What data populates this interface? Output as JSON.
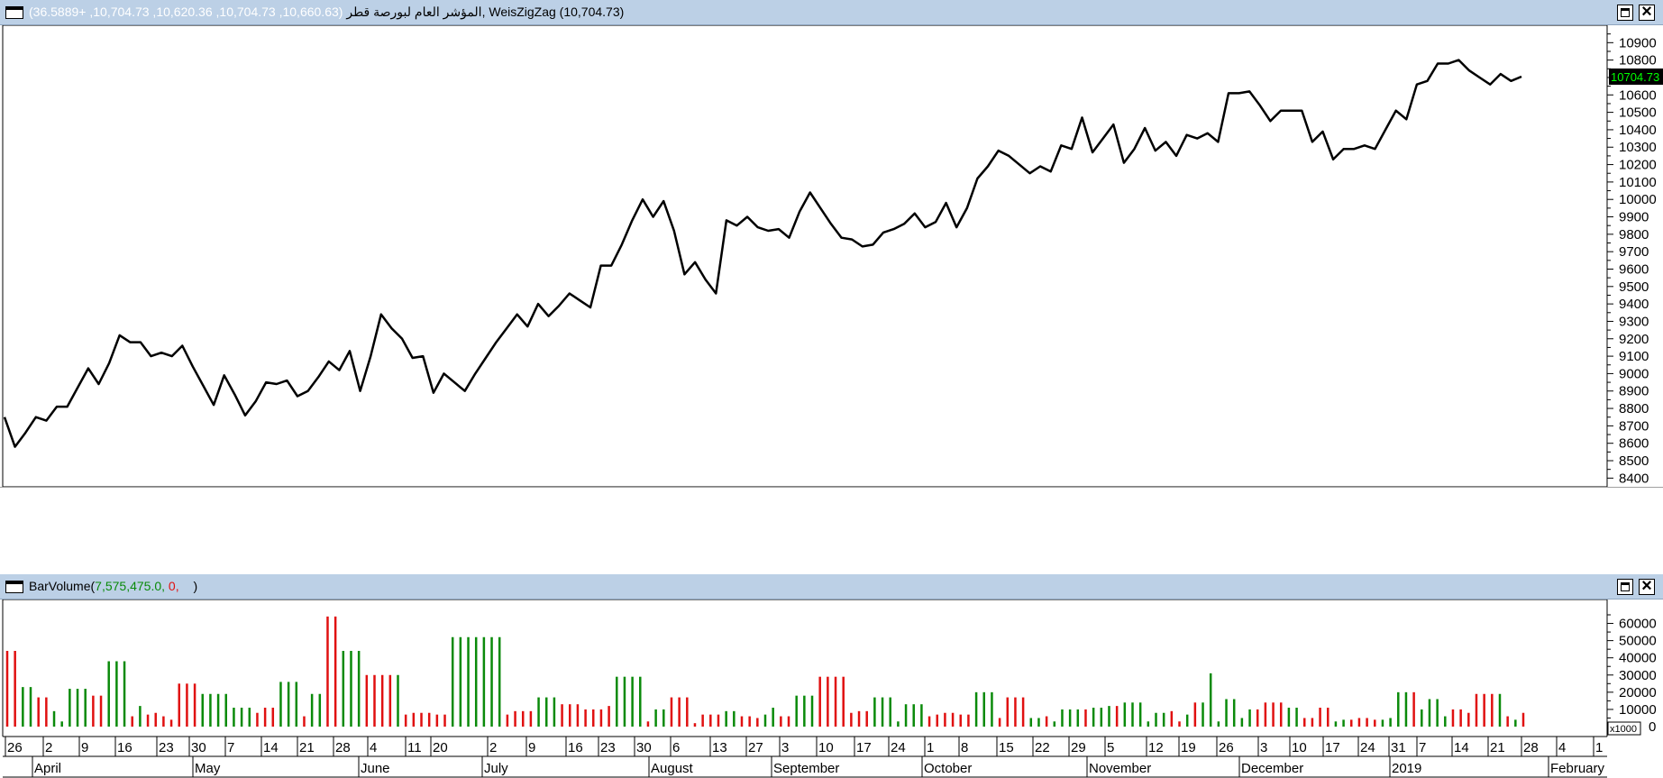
{
  "colors": {
    "titlebar": "#bcd0e6",
    "up_bar": "#0a8a0a",
    "down_bar": "#e01010",
    "price_line": "#000000",
    "last_price_badge_bg": "#000000",
    "last_price_badge_text": "#00ff00"
  },
  "price_panel": {
    "title": "المؤشر العام لبورصة قطر",
    "ohlc_values": "(10,660.63, 10,704.73, 10,620.36, 10,704.73, +36.5889)",
    "separator": ",",
    "indicator": "WeisZigZag (10,704.73)",
    "last_price_label": "10704.73",
    "maximize_icon": "maximize-icon",
    "close_icon": "close-icon"
  },
  "volume_panel": {
    "name": "BarVolume",
    "open_paren": "(",
    "value_green": "7,575,475.0,",
    "value_red": "0,",
    "close_paren": ")",
    "scale_label": "x1000"
  },
  "x_axis": {
    "day_labels": [
      "26",
      "2",
      "9",
      "16",
      "23",
      "30",
      "7",
      "14",
      "21",
      "28",
      "4",
      "11",
      "20",
      "2",
      "9",
      "16",
      "23",
      "30",
      "6",
      "13",
      "27",
      "3",
      "10",
      "17",
      "24",
      "1",
      "8",
      "15",
      "22",
      "29",
      "5",
      "12",
      "19",
      "26",
      "3",
      "10",
      "17",
      "24",
      "31",
      "7",
      "14",
      "21",
      "28",
      "4",
      "1"
    ],
    "month_labels": [
      "April",
      "May",
      "June",
      "July",
      "August",
      "September",
      "October",
      "November",
      "December",
      "2019",
      "February"
    ]
  },
  "chart_data": [
    {
      "type": "line",
      "series": [
        {
          "name": "WeisZigZag",
          "values": [
            8750,
            8580,
            8660,
            8750,
            8730,
            8810,
            8810,
            8920,
            9030,
            8940,
            9060,
            9220,
            9180,
            9180,
            9100,
            9120,
            9100,
            9160,
            9040,
            8930,
            8820,
            8990,
            8880,
            8760,
            8840,
            8950,
            8940,
            8960,
            8870,
            8900,
            8980,
            9070,
            9020,
            9130,
            8900,
            9100,
            9340,
            9260,
            9200,
            9090,
            9100,
            8890,
            9000,
            8950,
            8900,
            9000,
            9090,
            9180,
            9260,
            9340,
            9270,
            9400,
            9330,
            9390,
            9460,
            9420,
            9380,
            9620,
            9620,
            9740,
            9880,
            10000,
            9900,
            9990,
            9820,
            9570,
            9640,
            9540,
            9460,
            9880,
            9850,
            9900,
            9840,
            9820,
            9830,
            9780,
            9930,
            10040,
            9950,
            9860,
            9780,
            9770,
            9730,
            9740,
            9810,
            9830,
            9860,
            9920,
            9840,
            9870,
            9980,
            9840,
            9950,
            10120,
            10190,
            10280,
            10250,
            10200,
            10150,
            10190,
            10160,
            10310,
            10290,
            10470,
            10270,
            10350,
            10430,
            10210,
            10290,
            10410,
            10280,
            10330,
            10250,
            10370,
            10350,
            10380,
            10330,
            10610,
            10610,
            10620,
            10540,
            10450,
            10510,
            10510,
            10510,
            10330,
            10390,
            10230,
            10290,
            10290,
            10310,
            10290,
            10400,
            10510,
            10460,
            10660,
            10680,
            10780,
            10780,
            10800,
            10740,
            10700,
            10660,
            10720,
            10680,
            10705
          ]
        }
      ],
      "ylim": [
        8350,
        11000
      ]
    },
    {
      "type": "bar",
      "ylabel": "x1000",
      "ylim": [
        0,
        65000
      ],
      "series": [
        {
          "name": "BarVolume",
          "values": [
            44000,
            44000,
            23000,
            23000,
            17000,
            17000,
            9000,
            3000,
            22000,
            22000,
            22000,
            18000,
            18000,
            38000,
            38000,
            38000,
            6000,
            12000,
            7000,
            8000,
            6000,
            4000,
            25000,
            25000,
            25000,
            19000,
            19000,
            19000,
            19000,
            11000,
            11000,
            11000,
            8000,
            11000,
            11000,
            26000,
            26000,
            26000,
            6000,
            19000,
            19000,
            64000,
            64000,
            44000,
            44000,
            44000,
            30000,
            30000,
            30000,
            30000,
            30000,
            7000,
            8000,
            8000,
            8000,
            7000,
            7000,
            52000,
            52000,
            52000,
            52000,
            52000,
            52000,
            52000,
            7000,
            9000,
            9000,
            9000,
            17000,
            17000,
            17000,
            13000,
            13000,
            13000,
            10000,
            10000,
            10000,
            12000,
            29000,
            29000,
            29000,
            29000,
            3000,
            10000,
            10000,
            17000,
            17000,
            17000,
            2000,
            7000,
            7000,
            7000,
            9000,
            9000,
            6000,
            6000,
            5000,
            7000,
            11000,
            6000,
            6000,
            18000,
            18000,
            18000,
            29000,
            29000,
            29000,
            29000,
            8000,
            9000,
            9000,
            17000,
            17000,
            17000,
            3000,
            13000,
            13000,
            13000,
            6000,
            7000,
            8000,
            8000,
            7000,
            7000,
            20000,
            20000,
            20000,
            5000,
            17000,
            17000,
            17000,
            5000,
            5000,
            6000,
            3000,
            10000,
            10000,
            10000,
            10000,
            11000,
            11000,
            12000,
            12000,
            14000,
            14000,
            14000,
            3000,
            8000,
            8000,
            9000,
            3000,
            7000,
            14000,
            14000,
            31000,
            3000,
            16000,
            16000,
            5000,
            10000,
            10000,
            14000,
            14000,
            14000,
            11000,
            11000,
            5000,
            5000,
            11000,
            11000,
            3000,
            4000,
            4000,
            5000,
            5000,
            4000,
            4000,
            5000,
            20000,
            20000,
            20000,
            10000,
            16000,
            16000,
            6000,
            10000,
            10000,
            8000,
            19000,
            19000,
            19000,
            19000,
            6000,
            4000,
            8000
          ],
          "up": [
            0,
            0,
            1,
            1,
            0,
            0,
            1,
            1,
            1,
            1,
            1,
            0,
            0,
            1,
            1,
            1,
            0,
            1,
            0,
            0,
            0,
            0,
            0,
            0,
            0,
            1,
            1,
            1,
            1,
            1,
            1,
            1,
            0,
            0,
            0,
            1,
            1,
            1,
            0,
            1,
            1,
            0,
            0,
            1,
            1,
            1,
            0,
            0,
            0,
            0,
            1,
            0,
            0,
            0,
            0,
            0,
            0,
            1,
            1,
            1,
            1,
            1,
            1,
            1,
            0,
            0,
            0,
            0,
            1,
            1,
            1,
            0,
            0,
            0,
            0,
            0,
            0,
            0,
            1,
            1,
            1,
            1,
            0,
            1,
            1,
            0,
            0,
            0,
            0,
            0,
            0,
            0,
            1,
            1,
            0,
            0,
            0,
            1,
            1,
            0,
            0,
            1,
            1,
            1,
            0,
            0,
            0,
            0,
            0,
            0,
            0,
            1,
            1,
            1,
            1,
            1,
            1,
            1,
            0,
            0,
            0,
            0,
            0,
            0,
            1,
            1,
            1,
            0,
            0,
            0,
            0,
            1,
            1,
            0,
            1,
            1,
            1,
            1,
            0,
            1,
            1,
            1,
            0,
            1,
            1,
            1,
            1,
            1,
            1,
            0,
            0,
            1,
            0,
            1,
            1,
            1,
            1,
            1,
            1,
            1,
            0,
            0,
            0,
            0,
            1,
            1,
            0,
            0,
            0,
            0,
            1,
            1,
            0,
            0,
            0,
            0,
            1,
            1,
            1,
            1,
            0,
            1,
            1,
            1,
            1,
            0,
            0,
            0,
            0,
            0,
            0,
            1,
            0,
            1
          ]
        }
      ]
    }
  ]
}
